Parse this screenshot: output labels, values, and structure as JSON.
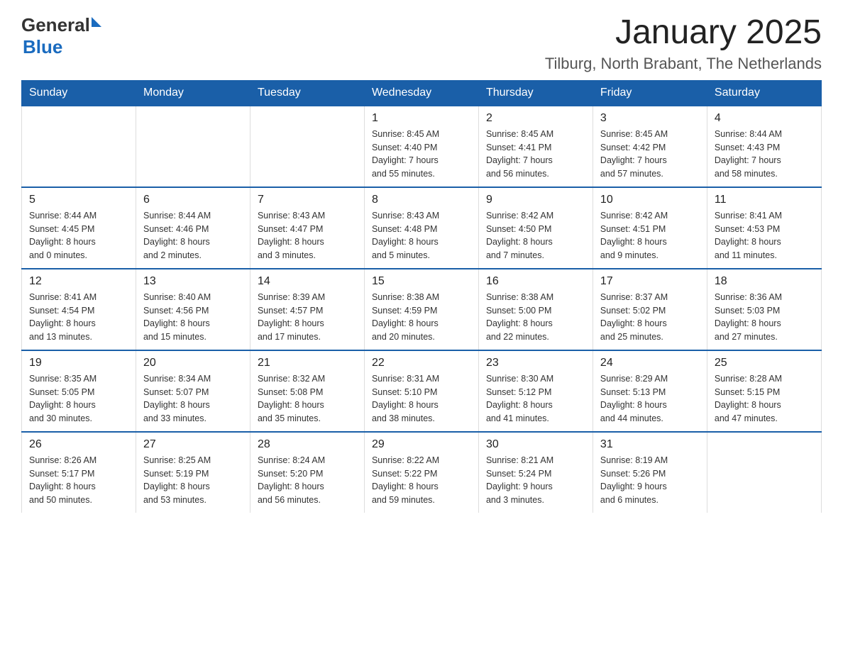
{
  "header": {
    "logo": {
      "general": "General",
      "triangle": "▶",
      "blue": "Blue"
    },
    "title": "January 2025",
    "location": "Tilburg, North Brabant, The Netherlands"
  },
  "calendar": {
    "days_of_week": [
      "Sunday",
      "Monday",
      "Tuesday",
      "Wednesday",
      "Thursday",
      "Friday",
      "Saturday"
    ],
    "weeks": [
      [
        {
          "day": "",
          "info": ""
        },
        {
          "day": "",
          "info": ""
        },
        {
          "day": "",
          "info": ""
        },
        {
          "day": "1",
          "info": "Sunrise: 8:45 AM\nSunset: 4:40 PM\nDaylight: 7 hours\nand 55 minutes."
        },
        {
          "day": "2",
          "info": "Sunrise: 8:45 AM\nSunset: 4:41 PM\nDaylight: 7 hours\nand 56 minutes."
        },
        {
          "day": "3",
          "info": "Sunrise: 8:45 AM\nSunset: 4:42 PM\nDaylight: 7 hours\nand 57 minutes."
        },
        {
          "day": "4",
          "info": "Sunrise: 8:44 AM\nSunset: 4:43 PM\nDaylight: 7 hours\nand 58 minutes."
        }
      ],
      [
        {
          "day": "5",
          "info": "Sunrise: 8:44 AM\nSunset: 4:45 PM\nDaylight: 8 hours\nand 0 minutes."
        },
        {
          "day": "6",
          "info": "Sunrise: 8:44 AM\nSunset: 4:46 PM\nDaylight: 8 hours\nand 2 minutes."
        },
        {
          "day": "7",
          "info": "Sunrise: 8:43 AM\nSunset: 4:47 PM\nDaylight: 8 hours\nand 3 minutes."
        },
        {
          "day": "8",
          "info": "Sunrise: 8:43 AM\nSunset: 4:48 PM\nDaylight: 8 hours\nand 5 minutes."
        },
        {
          "day": "9",
          "info": "Sunrise: 8:42 AM\nSunset: 4:50 PM\nDaylight: 8 hours\nand 7 minutes."
        },
        {
          "day": "10",
          "info": "Sunrise: 8:42 AM\nSunset: 4:51 PM\nDaylight: 8 hours\nand 9 minutes."
        },
        {
          "day": "11",
          "info": "Sunrise: 8:41 AM\nSunset: 4:53 PM\nDaylight: 8 hours\nand 11 minutes."
        }
      ],
      [
        {
          "day": "12",
          "info": "Sunrise: 8:41 AM\nSunset: 4:54 PM\nDaylight: 8 hours\nand 13 minutes."
        },
        {
          "day": "13",
          "info": "Sunrise: 8:40 AM\nSunset: 4:56 PM\nDaylight: 8 hours\nand 15 minutes."
        },
        {
          "day": "14",
          "info": "Sunrise: 8:39 AM\nSunset: 4:57 PM\nDaylight: 8 hours\nand 17 minutes."
        },
        {
          "day": "15",
          "info": "Sunrise: 8:38 AM\nSunset: 4:59 PM\nDaylight: 8 hours\nand 20 minutes."
        },
        {
          "day": "16",
          "info": "Sunrise: 8:38 AM\nSunset: 5:00 PM\nDaylight: 8 hours\nand 22 minutes."
        },
        {
          "day": "17",
          "info": "Sunrise: 8:37 AM\nSunset: 5:02 PM\nDaylight: 8 hours\nand 25 minutes."
        },
        {
          "day": "18",
          "info": "Sunrise: 8:36 AM\nSunset: 5:03 PM\nDaylight: 8 hours\nand 27 minutes."
        }
      ],
      [
        {
          "day": "19",
          "info": "Sunrise: 8:35 AM\nSunset: 5:05 PM\nDaylight: 8 hours\nand 30 minutes."
        },
        {
          "day": "20",
          "info": "Sunrise: 8:34 AM\nSunset: 5:07 PM\nDaylight: 8 hours\nand 33 minutes."
        },
        {
          "day": "21",
          "info": "Sunrise: 8:32 AM\nSunset: 5:08 PM\nDaylight: 8 hours\nand 35 minutes."
        },
        {
          "day": "22",
          "info": "Sunrise: 8:31 AM\nSunset: 5:10 PM\nDaylight: 8 hours\nand 38 minutes."
        },
        {
          "day": "23",
          "info": "Sunrise: 8:30 AM\nSunset: 5:12 PM\nDaylight: 8 hours\nand 41 minutes."
        },
        {
          "day": "24",
          "info": "Sunrise: 8:29 AM\nSunset: 5:13 PM\nDaylight: 8 hours\nand 44 minutes."
        },
        {
          "day": "25",
          "info": "Sunrise: 8:28 AM\nSunset: 5:15 PM\nDaylight: 8 hours\nand 47 minutes."
        }
      ],
      [
        {
          "day": "26",
          "info": "Sunrise: 8:26 AM\nSunset: 5:17 PM\nDaylight: 8 hours\nand 50 minutes."
        },
        {
          "day": "27",
          "info": "Sunrise: 8:25 AM\nSunset: 5:19 PM\nDaylight: 8 hours\nand 53 minutes."
        },
        {
          "day": "28",
          "info": "Sunrise: 8:24 AM\nSunset: 5:20 PM\nDaylight: 8 hours\nand 56 minutes."
        },
        {
          "day": "29",
          "info": "Sunrise: 8:22 AM\nSunset: 5:22 PM\nDaylight: 8 hours\nand 59 minutes."
        },
        {
          "day": "30",
          "info": "Sunrise: 8:21 AM\nSunset: 5:24 PM\nDaylight: 9 hours\nand 3 minutes."
        },
        {
          "day": "31",
          "info": "Sunrise: 8:19 AM\nSunset: 5:26 PM\nDaylight: 9 hours\nand 6 minutes."
        },
        {
          "day": "",
          "info": ""
        }
      ]
    ]
  }
}
